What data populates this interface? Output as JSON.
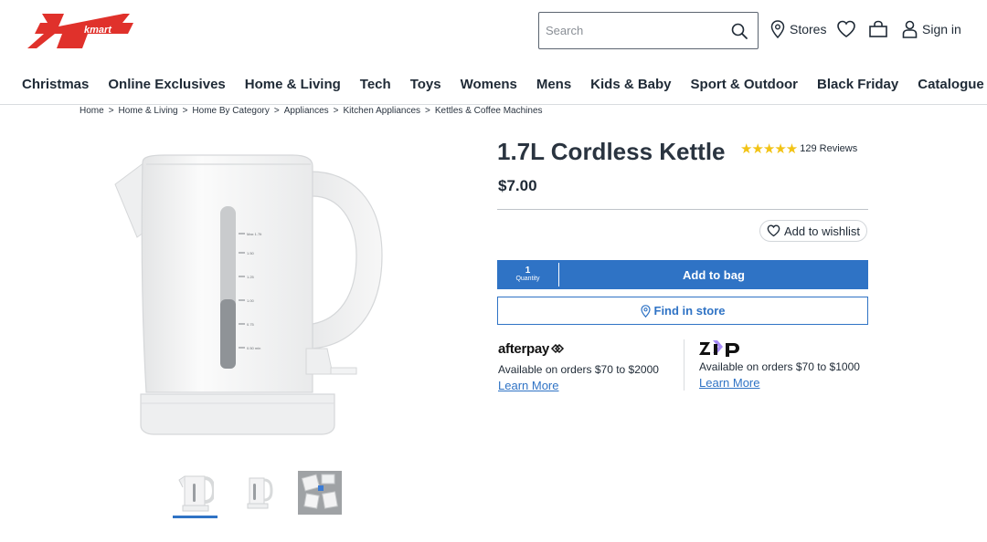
{
  "brand": {
    "logo_text": "kmart",
    "logo_color": "#e0312b"
  },
  "header": {
    "search_placeholder": "Search",
    "stores_label": "Stores",
    "signin_label": "Sign in"
  },
  "nav": [
    "Christmas",
    "Online Exclusives",
    "Home & Living",
    "Tech",
    "Toys",
    "Womens",
    "Mens",
    "Kids & Baby",
    "Sport & Outdoor",
    "Black Friday",
    "Catalogue"
  ],
  "breadcrumb": [
    "Home",
    "Home & Living",
    "Home By Category",
    "Appliances",
    "Kitchen Appliances",
    "Kettles & Coffee Machines"
  ],
  "breadcrumb_sep": ">",
  "product": {
    "title": "1.7L Cordless Kettle",
    "price": "$7.00",
    "rating": 4.5,
    "stars": "★★★★★",
    "reviews": "129 Reviews",
    "wishlist_label": "Add to wishlist",
    "quantity_value": "1",
    "quantity_label": "Quantity",
    "add_to_bag_label": "Add to bag",
    "find_in_store_label": "Find in store",
    "gauge_labels": [
      "Max 1.7lt",
      "1.50",
      "1.25",
      "1.00",
      "0.75",
      "0.50 min"
    ]
  },
  "payments": {
    "afterpay": {
      "logo": "afterpay",
      "text": "Available on orders $70 to $2000",
      "link": "Learn More"
    },
    "zip": {
      "logo": "zip",
      "text": "Available on orders $70 to $1000",
      "link": "Learn More"
    }
  },
  "colors": {
    "primary_blue": "#2f73c5",
    "star": "#f2c315",
    "text": "#1f2a36"
  }
}
